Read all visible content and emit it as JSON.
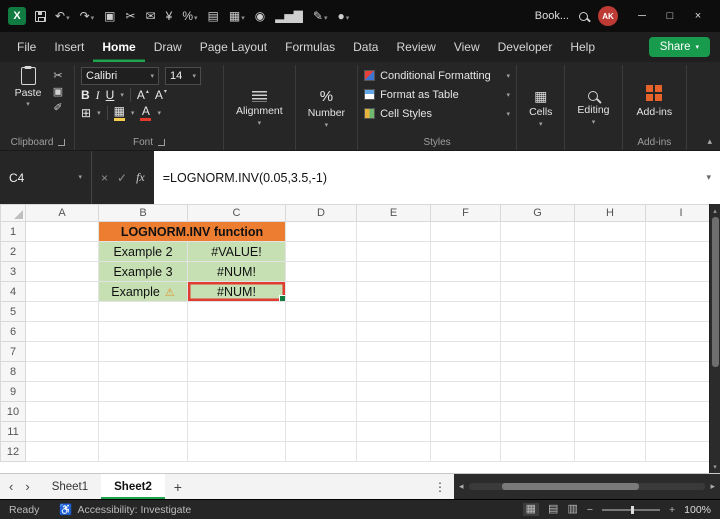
{
  "theme": {
    "accent_green": "#1FA34F",
    "share_green": "#189B4C",
    "avatar_red": "#BE3A34",
    "addins_orange": "#E8622C"
  },
  "icons": {
    "chevron_down": "▾",
    "chevron_up": "▴",
    "undo": "↶",
    "redo": "↷",
    "copy": "▣",
    "cut": "✂",
    "mail": "✉",
    "currency": "¥",
    "percent": "%",
    "printer": "▤",
    "table": "▦",
    "camera": "◉",
    "chart": "▂▅▇",
    "pen": "✎",
    "record": "●",
    "brush": "✐",
    "borders": "⊞",
    "check": "✓",
    "close": "×",
    "minimize": "─",
    "maximize": "□",
    "dots": "⋮",
    "prev": "‹",
    "next": "›",
    "left": "◂",
    "right": "▸",
    "plus": "+",
    "minus": "−",
    "warning": "⚠",
    "accessibility": "♿",
    "view_normal": "▦",
    "view_layout": "▤",
    "view_break": "▥"
  },
  "title_bar": {
    "app_initial": "X",
    "workbook": "Book...",
    "avatar_initials": "AK",
    "qat_icons": [
      {
        "name": "undo-button",
        "glyph_key": "undo",
        "chevron": true
      },
      {
        "name": "redo-button",
        "glyph_key": "redo",
        "chevron": true
      },
      {
        "name": "copy-button",
        "glyph_key": "copy"
      },
      {
        "name": "cut-button",
        "glyph_key": "cut"
      },
      {
        "name": "mail-button",
        "glyph_key": "mail"
      },
      {
        "name": "currency-style-button",
        "glyph_key": "currency"
      },
      {
        "name": "percent-style-button",
        "glyph_key": "percent",
        "chevron": true
      },
      {
        "name": "print-button",
        "glyph_key": "printer"
      },
      {
        "name": "table-button",
        "glyph_key": "table",
        "chevron": true
      },
      {
        "name": "camera-button",
        "glyph_key": "camera"
      },
      {
        "name": "chart-button",
        "glyph_key": "chart"
      },
      {
        "name": "draw-pen-button",
        "glyph_key": "pen",
        "chevron": true
      },
      {
        "name": "record-macro-button",
        "glyph_key": "record",
        "chevron": true
      }
    ]
  },
  "menu_bar": {
    "tabs": [
      "File",
      "Insert",
      "Home",
      "Draw",
      "Page Layout",
      "Formulas",
      "Data",
      "Review",
      "View",
      "Developer",
      "Help"
    ],
    "active_tab": "Home",
    "share_label": "Share"
  },
  "ribbon": {
    "clipboard": {
      "paste_label": "Paste",
      "group_label": "Clipboard"
    },
    "font": {
      "font_name": "Calibri",
      "font_size": "14",
      "bold": "B",
      "italic": "I",
      "underline": "U",
      "grow_shrink_letter": "A",
      "font_color_letter": "A",
      "group_label": "Font"
    },
    "alignment": {
      "label": "Alignment"
    },
    "number": {
      "label": "Number"
    },
    "styles": {
      "items": [
        "Conditional Formatting",
        "Format as Table",
        "Cell Styles"
      ],
      "group_label": "Styles"
    },
    "cells": {
      "label": "Cells"
    },
    "editing": {
      "label": "Editing"
    },
    "addins": {
      "button_label": "Add-ins",
      "group_label": "Add-ins"
    }
  },
  "formula_bar": {
    "name_box": "C4",
    "fx_label": "fx",
    "formula": "=LOGNORM.INV(0.05,3.5,-1)"
  },
  "grid": {
    "columns": [
      "A",
      "B",
      "C",
      "D",
      "E",
      "F",
      "G",
      "H",
      "I"
    ],
    "row_count": 12,
    "selected_cell": "C4",
    "cells": [
      {
        "ref": "B1",
        "text": "LOGNORM.INV function",
        "colspan": 2,
        "style": "title"
      },
      {
        "ref": "B2",
        "text": "Example 2",
        "style": "green"
      },
      {
        "ref": "C2",
        "text": "#VALUE!",
        "style": "green"
      },
      {
        "ref": "B3",
        "text": "Example 3",
        "style": "green"
      },
      {
        "ref": "C3",
        "text": "#NUM!",
        "style": "green"
      },
      {
        "ref": "B4",
        "text": "Example",
        "style": "green",
        "warning": true
      },
      {
        "ref": "C4",
        "text": "#NUM!",
        "style": "green",
        "selected": true
      }
    ],
    "colors": {
      "title_bg": "#ED7D31",
      "title_text": "#9C3B00",
      "green_bg": "#C6E0B4",
      "green_border": "#70AD47",
      "selection_red": "#E03C31",
      "fill_handle_green": "#107C41"
    }
  },
  "sheet_tabs": {
    "tabs": [
      "Sheet1",
      "Sheet2"
    ],
    "active": "Sheet2"
  },
  "status_bar": {
    "mode": "Ready",
    "accessibility": "Accessibility: Investigate",
    "zoom": "100%"
  }
}
